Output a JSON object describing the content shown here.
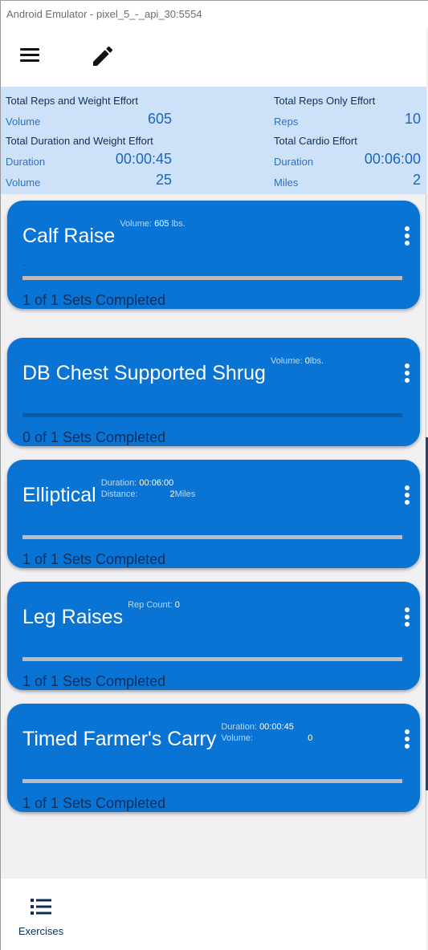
{
  "window": {
    "title": "Android Emulator - pixel_5_-_api_30:5554"
  },
  "toolbar": {
    "menu_icon": "menu-icon",
    "edit_icon": "pencil-icon"
  },
  "summary": {
    "reps_weight": {
      "heading": "Total Reps and Weight Effort",
      "volume_label": "Volume",
      "volume_value": "605"
    },
    "reps_only": {
      "heading": "Total Reps Only Effort",
      "reps_label": "Reps",
      "reps_value": "10"
    },
    "duration_weight": {
      "heading": "Total Duration and Weight Effort",
      "duration_label": "Duration",
      "duration_value": "00:00:45",
      "volume_label": "Volume",
      "volume_value": "25"
    },
    "cardio": {
      "heading": "Total Cardio Effort",
      "duration_label": "Duration",
      "duration_value": "00:06:00",
      "miles_label": "Miles",
      "miles_value": "2"
    }
  },
  "exercises": [
    {
      "name": "Calf Raise",
      "meta1_label": "Volume:",
      "meta1_value": "605",
      "meta1_unit": "lbs.",
      "note": ".",
      "sets_text": "1 of 1 Sets Completed",
      "progress": 1.0
    },
    {
      "name": "DB Chest Supported Shrug",
      "meta1_label": "Volume:",
      "meta1_value": "0",
      "meta1_unit": "lbs.",
      "sets_text": "0 of 1 Sets Completed",
      "progress": 0.0
    },
    {
      "name": "Elliptical",
      "meta1_label": "Duration:",
      "meta1_value": "00:06:00",
      "meta2_label": "Distance:",
      "meta2_value": "2",
      "meta2_unit": "Miles",
      "sets_text": "1 of 1 Sets Completed",
      "progress": 1.0
    },
    {
      "name": "Leg Raises",
      "meta1_label": "Rep Count:",
      "meta1_value": "0",
      "sets_text": "1 of 1 Sets Completed",
      "progress": 1.0
    },
    {
      "name": "Timed Farmer's Carry",
      "meta1_label": "Duration:",
      "meta1_value": "00:00:45",
      "meta2_label": "Volume:",
      "meta2_value": "0",
      "sets_text": "1 of 1 Sets Completed",
      "progress": 1.0
    }
  ],
  "bottom_nav": {
    "exercises_label": "Exercises",
    "exercises_icon": "list-icon"
  },
  "colors": {
    "card": "#0a74d5",
    "summary_bg": "#cde2f9",
    "accent_text": "#1a66bd"
  }
}
